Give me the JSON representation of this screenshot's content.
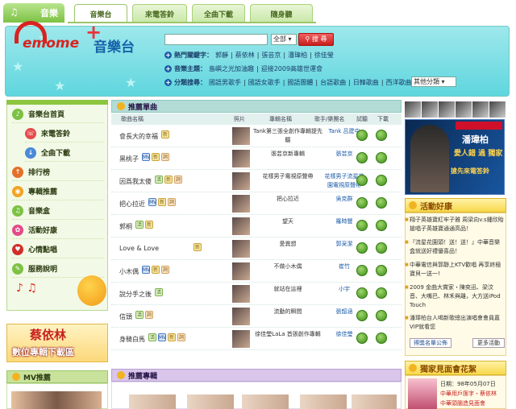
{
  "topbar": {
    "brand": "音樂",
    "tabs": [
      "音樂台",
      "來電答鈴",
      "全曲下載",
      "隨身聽"
    ]
  },
  "header": {
    "logo_emome": "emome",
    "logo_plus": "+",
    "logo_music": "音樂台",
    "search_placeholder": "",
    "search_select": "全部",
    "search_button": "搜 尋",
    "hot_label": "熱門關鍵字：",
    "hot_keywords": [
      "郭靜",
      "蔡依林",
      "張芸京",
      "潘瑋柏",
      "徐佳瑩"
    ],
    "promo_label": "音樂主題：",
    "promo_items": [
      "島嶼之光加油趣",
      "迎接2009高雄世運會"
    ],
    "category_label": "分類搜尋：",
    "categories": [
      "國語男歌手",
      "國語女歌手",
      "國語團體",
      "台語歌曲",
      "日韓歌曲",
      "西洋歌曲"
    ],
    "category_select": "其他分類"
  },
  "leftnav": {
    "items": [
      {
        "label": "音樂台首頁",
        "color": "#7cc243"
      },
      {
        "label": "來電答鈴",
        "color": "#e54a4a"
      },
      {
        "label": "全曲下載",
        "color": "#4a8ad8"
      },
      {
        "label": "排行榜",
        "color": "#e5702a"
      },
      {
        "label": "專輯推薦",
        "color": "#f2a322"
      },
      {
        "label": "音樂盒",
        "color": "#7cc243"
      },
      {
        "label": "活動好康",
        "color": "#e54a8a"
      },
      {
        "label": "心情點唱",
        "color": "#d0302a"
      },
      {
        "label": "服務說明",
        "color": "#7cc243"
      }
    ],
    "promo_title": "蔡依林",
    "promo_sub": "數位專輯下載區",
    "mv_label": "MV推薦"
  },
  "songs": {
    "title": "推薦單曲",
    "columns": [
      "歌曲名稱",
      "照片",
      "專輯名稱",
      "歌手/樂團名",
      "試聽",
      "下載"
    ],
    "rows": [
      {
        "name": "會長大的幸福",
        "badges": [
          "new"
        ],
        "album": "Tank第三張全創作專輯提先聽",
        "artist": "Tank 呂建中"
      },
      {
        "name": "黑桃子",
        "badges": [
          "mv",
          "new",
          "lyr"
        ],
        "album": "張芸京新專輯",
        "artist": "張芸京"
      },
      {
        "name": "因爲我太傻",
        "badges": [
          "hot",
          "new",
          "lyr"
        ],
        "album": "花樣男子電視原聲帶",
        "artist": "花樣男子流星花園電視原聲帶"
      },
      {
        "name": "把心拉近",
        "badges": [
          "mv",
          "new",
          "lyr"
        ],
        "album": "把心拉近",
        "artist": "吳克群"
      },
      {
        "name": "郭桐",
        "badges": [
          "hot",
          "new"
        ],
        "album": "望天",
        "artist": "羅時豐"
      },
      {
        "name": "Love & Love",
        "badges": [
          "new"
        ],
        "album": "愛異想",
        "artist": "郭采潔"
      },
      {
        "name": "小木偶",
        "badges": [
          "mv",
          "new",
          "lyr"
        ],
        "album": "不做小木偶",
        "artist": "崔竹"
      },
      {
        "name": "說分手之後",
        "badges": [
          "hot"
        ],
        "album": "就站在這裡",
        "artist": "小宇"
      },
      {
        "name": "信頭",
        "badges": [
          "hot",
          "lyr"
        ],
        "album": "流動的瞬間",
        "artist": "張韶涵"
      },
      {
        "name": "身騎白馬",
        "badges": [
          "hot",
          "mv",
          "new",
          "lyr"
        ],
        "album": "徐佳瑩LaLa 首張創作專輯",
        "artist": "徐佳瑩"
      }
    ]
  },
  "albums": {
    "title": "推薦專輯"
  },
  "right": {
    "ad_name": "潘瑋柏",
    "ad_line2": "愛人錯 過 獨家",
    "ad_line3": "搶先來電答鈴",
    "activity_title": "活動好康",
    "activities": [
      "翔子英雄寶紅牢子雅 周梁向v.s鍾欣貽 搶唱子英雄寶通通高品！",
      "『流星花園頭！送！送！』中華音樂盒就送好禮優喜品！",
      "中華電信與郭靜上KTV歡唱 再享終極寶貝一送一!",
      "2009 金曲大賞家・陳奕迅、梁汶音、大嘴巴、林禾與離，大方送iPod Touch",
      "潘瑋柏台人喝新歌總出演唱會會員嘉VIP就看您"
    ],
    "activity_button": "得獎名單公佈",
    "activity_more": "更多活動",
    "exclusive_title": "獨家見面會花絮",
    "exclusive_lines": [
      "日期：98年05月07日",
      "中華用戶匯字・蔡依林",
      "中華頭腦造見面會"
    ]
  }
}
